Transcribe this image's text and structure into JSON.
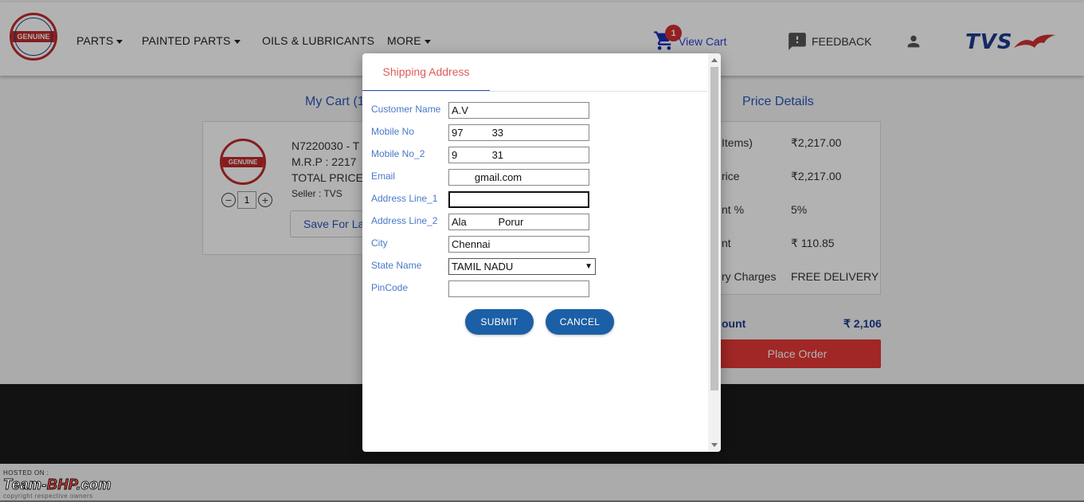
{
  "header": {
    "logo_text": "GENUINE",
    "nav": [
      {
        "label": "PARTS",
        "has_dropdown": true
      },
      {
        "label": "PAINTED PARTS",
        "has_dropdown": true
      },
      {
        "label": "OILS & LUBRICANTS",
        "has_dropdown": false
      },
      {
        "label": "MORE",
        "has_dropdown": true
      }
    ],
    "cart_count": "1",
    "view_cart_label": "View Cart",
    "feedback_label": "FEEDBACK",
    "brand_text": "TVS"
  },
  "cart": {
    "title": "My Cart (1",
    "item": {
      "part_no": "N7220030 - T",
      "mrp": "M.R.P : 2217",
      "total_price": "TOTAL PRICE",
      "seller": "Seller : TVS",
      "quantity": "1"
    },
    "save_for_later_label": "Save For La"
  },
  "price_details": {
    "title": "Price Details",
    "rows": [
      {
        "label": "Items)",
        "value": "₹2,217.00"
      },
      {
        "label": "rice",
        "value": "₹2,217.00"
      },
      {
        "label": "nt %",
        "value": "5%"
      },
      {
        "label": "nt",
        "value": "₹ 110.85"
      },
      {
        "label": "ry Charges",
        "value": "FREE DELIVERY"
      }
    ],
    "total_label": "ount",
    "total_value": "₹ 2,106",
    "place_order_label": "Place Order"
  },
  "modal": {
    "tab_title": "Shipping Address",
    "fields": {
      "customer_name": {
        "label": "Customer Name",
        "value": "A.V"
      },
      "mobile_no": {
        "label": "Mobile No",
        "value": "97          33"
      },
      "mobile_no_2": {
        "label": "Mobile No_2",
        "value": "9            31"
      },
      "email": {
        "label": "Email",
        "value": "        gmail.com"
      },
      "address_line_1": {
        "label": "Address Line_1",
        "value": ""
      },
      "address_line_2": {
        "label": "Address Line_2",
        "value": "Ala           Porur"
      },
      "city": {
        "label": "City",
        "value": "Chennai"
      },
      "state": {
        "label": "State Name",
        "value": "TAMIL NADU"
      },
      "pincode": {
        "label": "PinCode",
        "value": ""
      }
    },
    "submit_label": "SUBMIT",
    "cancel_label": "CANCEL"
  },
  "watermark": {
    "hosted_on": "HOSTED ON :",
    "site_a": "Team-",
    "site_b": "BHP",
    "site_c": ".com",
    "copyright": "copyright respective owners"
  },
  "colors": {
    "accent_blue": "#2b56b8",
    "button_blue": "#1b5fa6",
    "place_order_red": "#e53935",
    "tab_title_red": "#e05a5a"
  }
}
